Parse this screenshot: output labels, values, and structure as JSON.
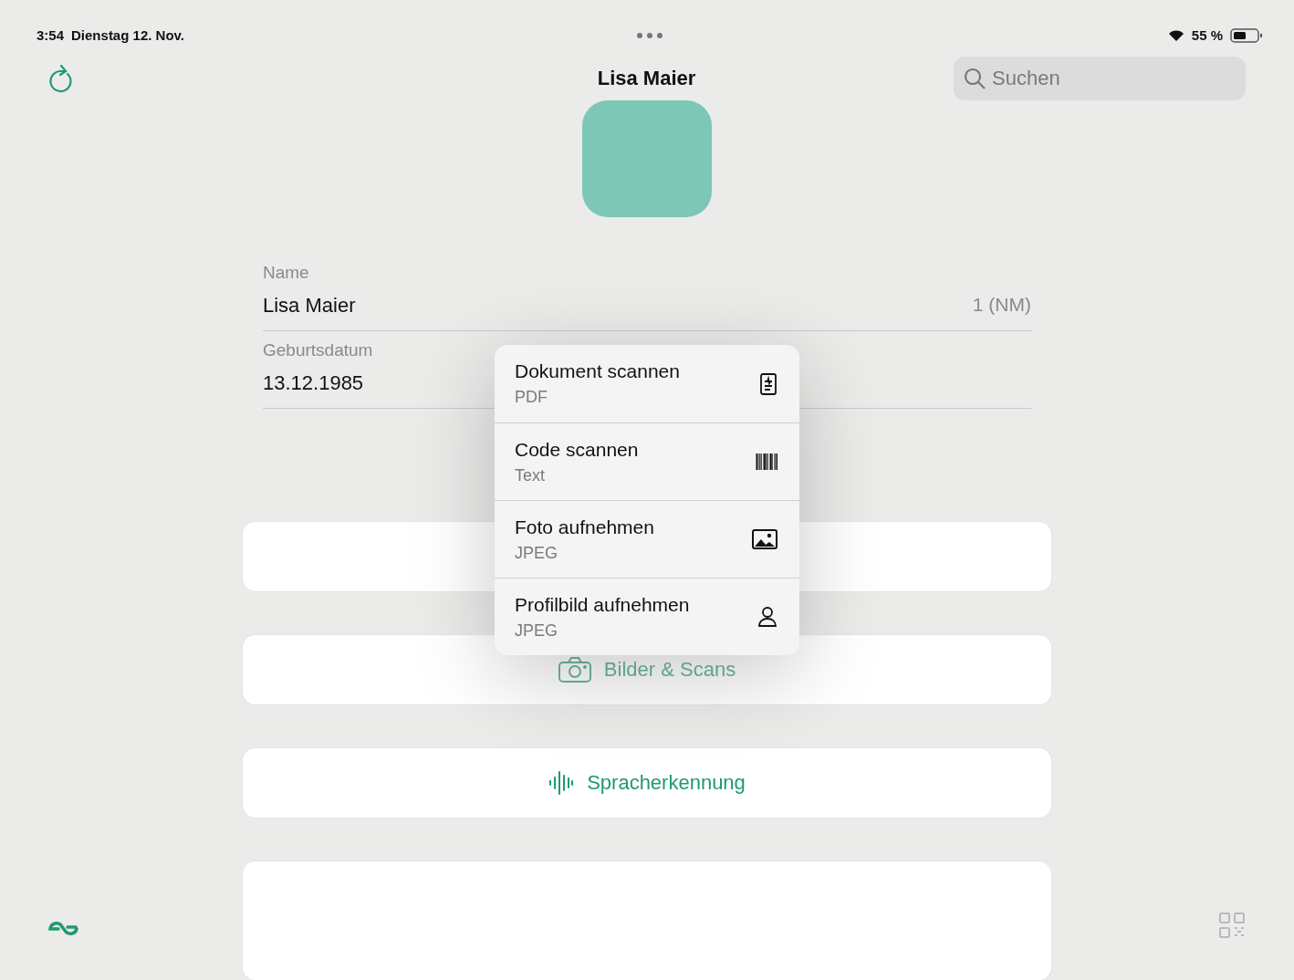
{
  "status_bar": {
    "time": "3:54",
    "date": "Dienstag 12. Nov.",
    "battery": "55 %"
  },
  "header": {
    "title": "Lisa Maier",
    "search": {
      "placeholder": "Suchen"
    }
  },
  "fields": [
    {
      "label": "Name",
      "value": "Lisa Maier",
      "note": "1 (NM)"
    },
    {
      "label": "Geburtsdatum",
      "value": "13.12.1985"
    }
  ],
  "cards": [
    {
      "kind": "empty"
    },
    {
      "kind": "photos",
      "label": "Bilder & Scans",
      "dimmed": true
    },
    {
      "kind": "voice",
      "label": "Spracherkennung",
      "dimmed": false
    },
    {
      "kind": "empty"
    }
  ],
  "menu": {
    "items": [
      {
        "kind": "document",
        "title": "Dokument scannen",
        "subtitle": "PDF"
      },
      {
        "kind": "barcode",
        "title": "Code scannen",
        "subtitle": "Text"
      },
      {
        "kind": "photo",
        "title": "Foto aufnehmen",
        "subtitle": "JPEG"
      },
      {
        "kind": "person",
        "title": "Profilbild aufnehmen",
        "subtitle": "JPEG"
      }
    ]
  }
}
